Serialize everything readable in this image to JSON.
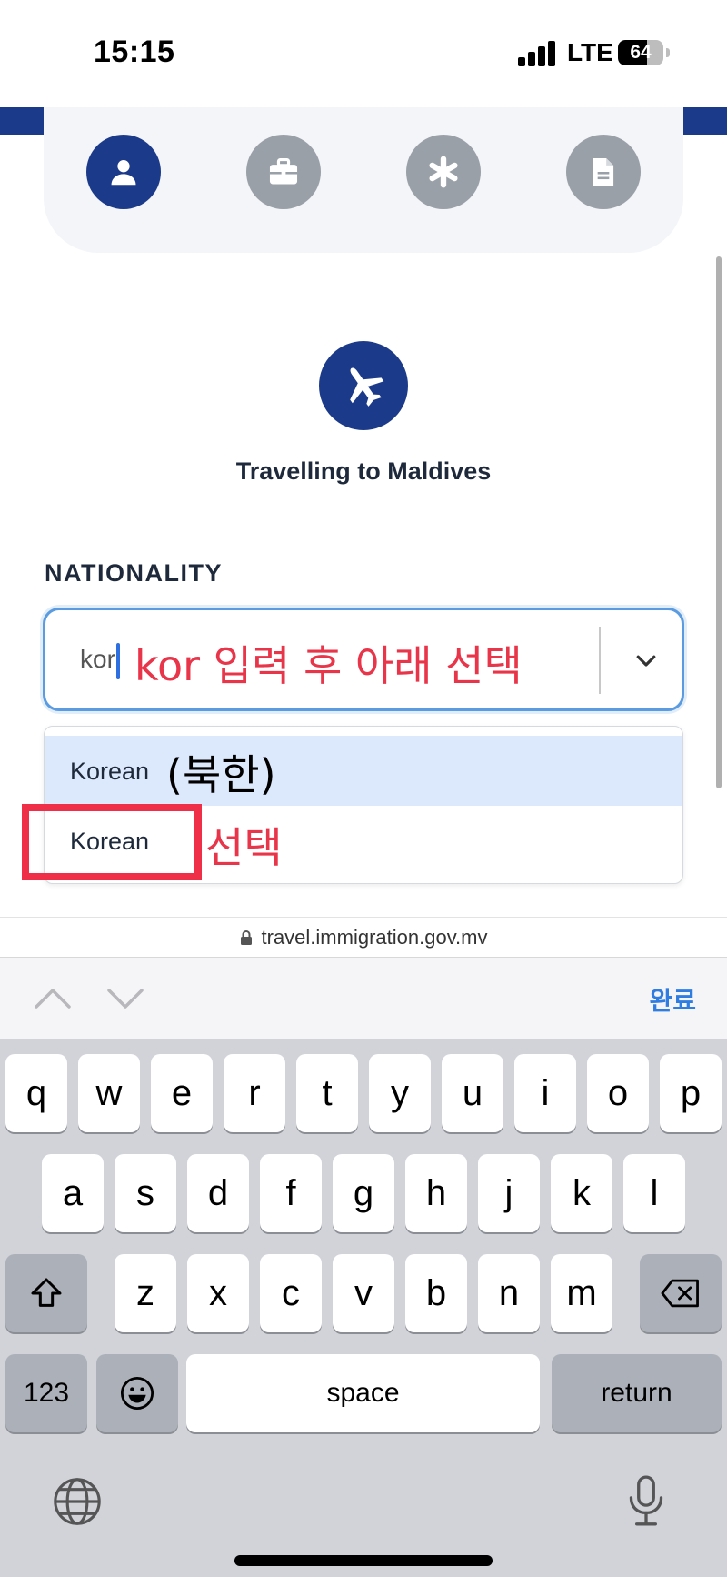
{
  "status_bar": {
    "time": "15:15",
    "network": "LTE",
    "battery": "64",
    "battery_level": 0.64
  },
  "steps": [
    {
      "name": "personal",
      "icon": "person-icon",
      "active": true
    },
    {
      "name": "travel",
      "icon": "briefcase-icon",
      "active": false
    },
    {
      "name": "health",
      "icon": "asterisk-icon",
      "active": false
    },
    {
      "name": "documents",
      "icon": "document-icon",
      "active": false
    }
  ],
  "hero": {
    "icon": "airplane-icon",
    "title": "Travelling to Maldives"
  },
  "nationality": {
    "label": "NATIONALITY",
    "input_value": "kor",
    "options": [
      "Korean",
      "Korean"
    ]
  },
  "annotations": {
    "input_hint": "kor 입력 후 아래 선택",
    "north_korea": "(북한)",
    "select_hint": "선택",
    "highlight_color": "#ef2f47"
  },
  "browser": {
    "url": "travel.immigration.gov.mv"
  },
  "accessory": {
    "done_label": "완료"
  },
  "keyboard": {
    "row1": [
      "q",
      "w",
      "e",
      "r",
      "t",
      "y",
      "u",
      "i",
      "o",
      "p"
    ],
    "row2": [
      "a",
      "s",
      "d",
      "f",
      "g",
      "h",
      "j",
      "k",
      "l"
    ],
    "row3": [
      "z",
      "x",
      "c",
      "v",
      "b",
      "n",
      "m"
    ],
    "numbers_label": "123",
    "space_label": "space",
    "return_label": "return"
  }
}
